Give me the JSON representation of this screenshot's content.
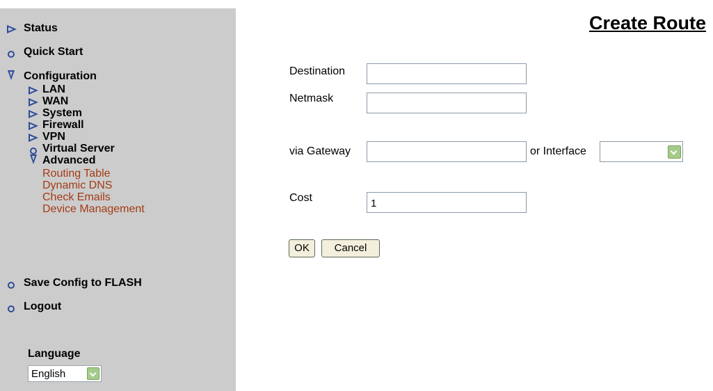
{
  "sidebar": {
    "items": [
      {
        "label": "Status",
        "icon": "triangle-right-icon"
      },
      {
        "label": "Quick Start",
        "icon": "circle-icon"
      },
      {
        "label": "Configuration",
        "icon": "triangle-down-icon"
      },
      {
        "label": "Save Config to FLASH",
        "icon": "circle-icon"
      },
      {
        "label": "Logout",
        "icon": "circle-icon"
      }
    ],
    "config_sub": [
      {
        "label": "LAN",
        "icon": "triangle-right-icon"
      },
      {
        "label": "WAN",
        "icon": "triangle-right-icon"
      },
      {
        "label": "System",
        "icon": "triangle-right-icon"
      },
      {
        "label": "Firewall",
        "icon": "triangle-right-icon"
      },
      {
        "label": "VPN",
        "icon": "triangle-right-icon"
      },
      {
        "label": "Virtual Server",
        "icon": "circle-icon"
      },
      {
        "label": "Advanced",
        "icon": "triangle-down-icon"
      }
    ],
    "advanced_links": [
      "Routing Table",
      "Dynamic DNS",
      "Check Emails",
      "Device Management"
    ],
    "language_label": "Language",
    "language_value": "English"
  },
  "page": {
    "title": "Create Route"
  },
  "form": {
    "destination_label": "Destination",
    "destination_value": "",
    "netmask_label": "Netmask",
    "netmask_value": "",
    "gateway_label": "via Gateway",
    "gateway_value": "",
    "interface_label": "or Interface",
    "interface_value": "",
    "cost_label": "Cost",
    "cost_value": "1",
    "ok_label": "OK",
    "cancel_label": "Cancel"
  },
  "colors": {
    "sidebar_bg": "#cccccc",
    "icon_blue": "#2e4b98",
    "link_red": "#a33b16",
    "dropdown_green": "#a5cc8a"
  }
}
